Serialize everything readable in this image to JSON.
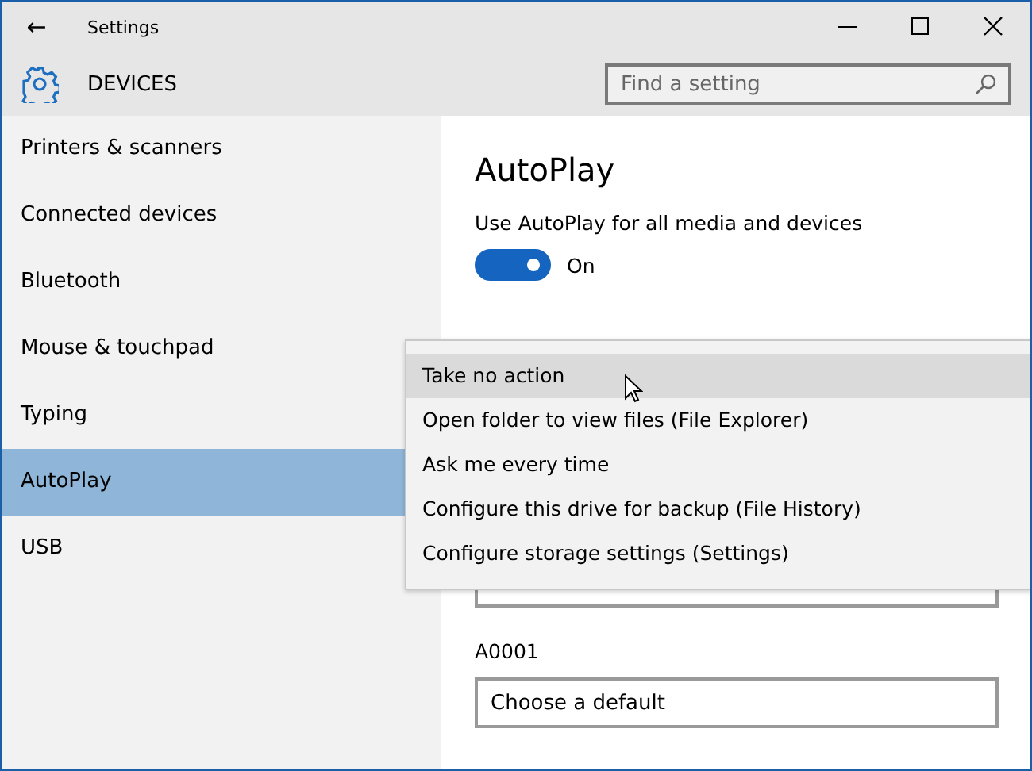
{
  "window": {
    "title": "Settings",
    "back": "←"
  },
  "header": {
    "title": "DEVICES",
    "search": {
      "placeholder": "Find a setting"
    }
  },
  "sidebar": {
    "items": [
      {
        "label": "Printers & scanners",
        "selected": false
      },
      {
        "label": "Connected devices",
        "selected": false
      },
      {
        "label": "Bluetooth",
        "selected": false
      },
      {
        "label": "Mouse & touchpad",
        "selected": false
      },
      {
        "label": "Typing",
        "selected": false
      },
      {
        "label": "AutoPlay",
        "selected": true
      },
      {
        "label": "USB",
        "selected": false
      }
    ]
  },
  "content": {
    "heading": "AutoPlay",
    "toggle_label": "Use AutoPlay for all media and devices",
    "toggle": {
      "on": true,
      "text": "On"
    },
    "devices": [
      {
        "label": "A0001",
        "value": "Choose a default"
      }
    ]
  },
  "menu": {
    "items": [
      {
        "label": "Take no action",
        "selected": true
      },
      {
        "label": "Open folder to view files (File Explorer)",
        "selected": false
      },
      {
        "label": "Ask me every time",
        "selected": false
      },
      {
        "label": "Configure this drive for backup (File History)",
        "selected": false
      },
      {
        "label": "Configure storage settings (Settings)",
        "selected": false
      }
    ]
  }
}
